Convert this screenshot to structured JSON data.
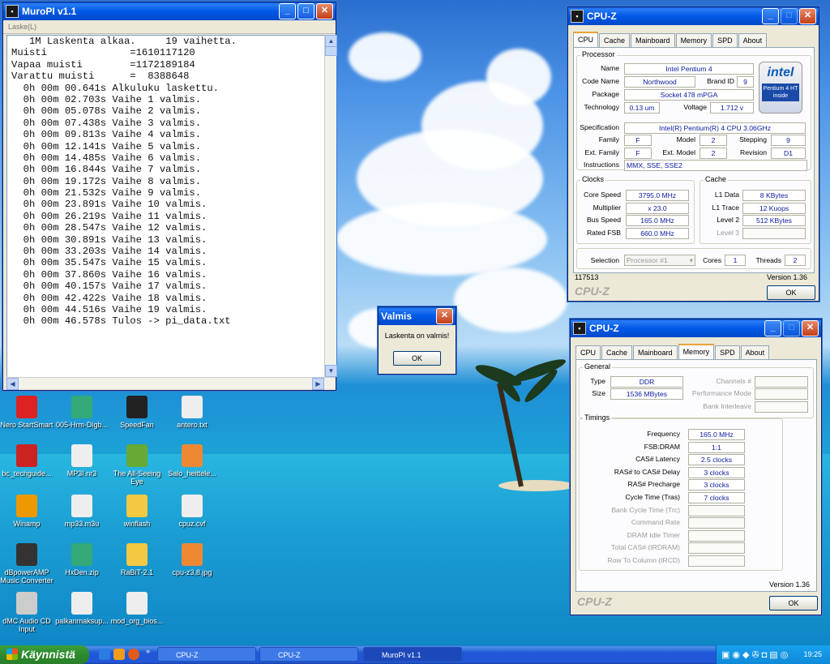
{
  "muropi": {
    "title": "MuroPI v1.1",
    "menu": "Laske(L)",
    "lines": [
      "   1M Laskenta alkaa.     19 vaihetta.",
      "Muisti              =1610117120",
      "Vapaa muisti        =1172189184",
      "Varattu muisti      =  8388648",
      "  0h 00m 00.641s Alkuluku laskettu.",
      "  0h 00m 02.703s Vaihe 1 valmis.",
      "  0h 00m 05.078s Vaihe 2 valmis.",
      "  0h 00m 07.438s Vaihe 3 valmis.",
      "  0h 00m 09.813s Vaihe 4 valmis.",
      "  0h 00m 12.141s Vaihe 5 valmis.",
      "  0h 00m 14.485s Vaihe 6 valmis.",
      "  0h 00m 16.844s Vaihe 7 valmis.",
      "  0h 00m 19.172s Vaihe 8 valmis.",
      "  0h 00m 21.532s Vaihe 9 valmis.",
      "  0h 00m 23.891s Vaihe 10 valmis.",
      "  0h 00m 26.219s Vaihe 11 valmis.",
      "  0h 00m 28.547s Vaihe 12 valmis.",
      "  0h 00m 30.891s Vaihe 13 valmis.",
      "  0h 00m 33.203s Vaihe 14 valmis.",
      "  0h 00m 35.547s Vaihe 15 valmis.",
      "  0h 00m 37.860s Vaihe 16 valmis.",
      "  0h 00m 40.157s Vaihe 17 valmis.",
      "  0h 00m 42.422s Vaihe 18 valmis.",
      "  0h 00m 44.516s Vaihe 19 valmis.",
      "  0h 00m 46.578s Tulos -> pi_data.txt"
    ]
  },
  "dialog": {
    "title": "Valmis",
    "message": "Laskenta on valmis!",
    "ok": "OK"
  },
  "cpuz1": {
    "title": "CPU-Z",
    "tabs": [
      "CPU",
      "Cache",
      "Mainboard",
      "Memory",
      "SPD",
      "About"
    ],
    "processor_group": "Processor",
    "name_label": "Name",
    "name": "Intel Pentium 4",
    "codename_label": "Code Name",
    "codename": "Northwood",
    "brandid_label": "Brand ID",
    "brandid": "9",
    "package_label": "Package",
    "package": "Socket 478 mPGA",
    "tech_label": "Technology",
    "tech": "0.13 um",
    "voltage_label": "Voltage",
    "voltage": "1.712 v",
    "spec_label": "Specification",
    "spec": "Intel(R) Pentium(R) 4 CPU 3.06GHz",
    "family_label": "Family",
    "family": "F",
    "model_label": "Model",
    "model": "2",
    "stepping_label": "Stepping",
    "stepping": "9",
    "extfamily_label": "Ext. Family",
    "extfamily": "F",
    "extmodel_label": "Ext. Model",
    "extmodel": "2",
    "revision_label": "Revision",
    "revision": "D1",
    "instr_label": "Instructions",
    "instr": "MMX, SSE, SSE2",
    "logo_text": "intel",
    "logo_sub": "Pentium 4 HT inside",
    "clocks_group": "Clocks",
    "corespeed_label": "Core Speed",
    "corespeed": "3795.0 MHz",
    "multiplier_label": "Multiplier",
    "multiplier": "x 23.0",
    "busspeed_label": "Bus Speed",
    "busspeed": "165.0 MHz",
    "ratedfsb_label": "Rated FSB",
    "ratedfsb": "660.0 MHz",
    "cache_group": "Cache",
    "l1data_label": "L1 Data",
    "l1data": "8 KBytes",
    "l1trace_label": "L1 Trace",
    "l1trace": "12 Kuops",
    "level2_label": "Level 2",
    "level2": "512 KBytes",
    "level3_label": "Level 3",
    "selection_label": "Selection",
    "selection": "Processor #1",
    "cores_label": "Cores",
    "cores": "1",
    "threads_label": "Threads",
    "threads": "2",
    "id": "117513",
    "version": "Version 1.36",
    "brand": "CPU-Z",
    "ok": "OK"
  },
  "cpuz2": {
    "title": "CPU-Z",
    "tabs": [
      "CPU",
      "Cache",
      "Mainboard",
      "Memory",
      "SPD",
      "About"
    ],
    "general_group": "General",
    "type_label": "Type",
    "type": "DDR",
    "size_label": "Size",
    "size": "1536 MBytes",
    "channels_label": "Channels #",
    "perfmode_label": "Performance Mode",
    "bankinter_label": "Bank Interleave",
    "timings_group": "Timings",
    "timings": [
      {
        "label": "Frequency",
        "value": "165.0 MHz"
      },
      {
        "label": "FSB:DRAM",
        "value": "1:1"
      },
      {
        "label": "CAS# Latency",
        "value": "2.5 clocks"
      },
      {
        "label": "RAS# to CAS# Delay",
        "value": "3 clocks"
      },
      {
        "label": "RAS# Precharge",
        "value": "3 clocks"
      },
      {
        "label": "Cycle Time (Tras)",
        "value": "7 clocks"
      },
      {
        "label": "Bank Cycle Time (Trc)",
        "value": ""
      },
      {
        "label": "Command Rate",
        "value": ""
      },
      {
        "label": "DRAM Idle Timer",
        "value": ""
      },
      {
        "label": "Total CAS# (tRDRAM)",
        "value": ""
      },
      {
        "label": "Row To Column (tRCD)",
        "value": ""
      }
    ],
    "version": "Version 1.36",
    "brand": "CPU-Z",
    "ok": "OK"
  },
  "desktop_icons": [
    {
      "label": "Nero StartSmart",
      "icon": "nero-icon",
      "color": "#d22"
    },
    {
      "label": "005-Hrm-Digb...",
      "icon": "zip-icon",
      "color": "#3a7"
    },
    {
      "label": "SpeedFan",
      "icon": "speedfan-icon",
      "color": "#222"
    },
    {
      "label": "antero.txt",
      "icon": "text-file-icon",
      "color": "#eee"
    },
    {
      "label": "bc_techguide...",
      "icon": "pdf-icon",
      "color": "#c22"
    },
    {
      "label": "MP3I.nr3",
      "icon": "mp3-icon",
      "color": "#eee"
    },
    {
      "label": "The All-Seeing Eye",
      "icon": "eye-icon",
      "color": "#6a3"
    },
    {
      "label": "Salo_heittele...",
      "icon": "image-file-icon",
      "color": "#e83"
    },
    {
      "label": "Winamp",
      "icon": "winamp-icon",
      "color": "#e90"
    },
    {
      "label": "mp33.m3u",
      "icon": "playlist-icon",
      "color": "#eee"
    },
    {
      "label": "winflash",
      "icon": "folder-icon",
      "color": "#f3c842"
    },
    {
      "label": "cpuz.cvf",
      "icon": "file-icon",
      "color": "#eee"
    },
    {
      "label": "dBpowerAMP Music Converter",
      "icon": "dbpoweramp-icon",
      "color": "#333"
    },
    {
      "label": "HxDen.zip",
      "icon": "zip-icon",
      "color": "#3a7"
    },
    {
      "label": "RaBiT-2.1",
      "icon": "folder-icon",
      "color": "#f3c842"
    },
    {
      "label": "cpu-z3,8.jpg",
      "icon": "image-file-icon",
      "color": "#e83"
    },
    {
      "label": "dMC Audio CD Input",
      "icon": "cd-icon",
      "color": "#ccc"
    },
    {
      "label": "palkanmaksup...",
      "icon": "word-doc-icon",
      "color": "#eee"
    },
    {
      "label": "mod_org_bios...",
      "icon": "file-icon",
      "color": "#eee"
    }
  ],
  "taskbar": {
    "start": "Käynnistä",
    "tasks": [
      "CPU-Z",
      "CPU-Z",
      "MuroPI v1.1"
    ],
    "clock": "19:25"
  }
}
